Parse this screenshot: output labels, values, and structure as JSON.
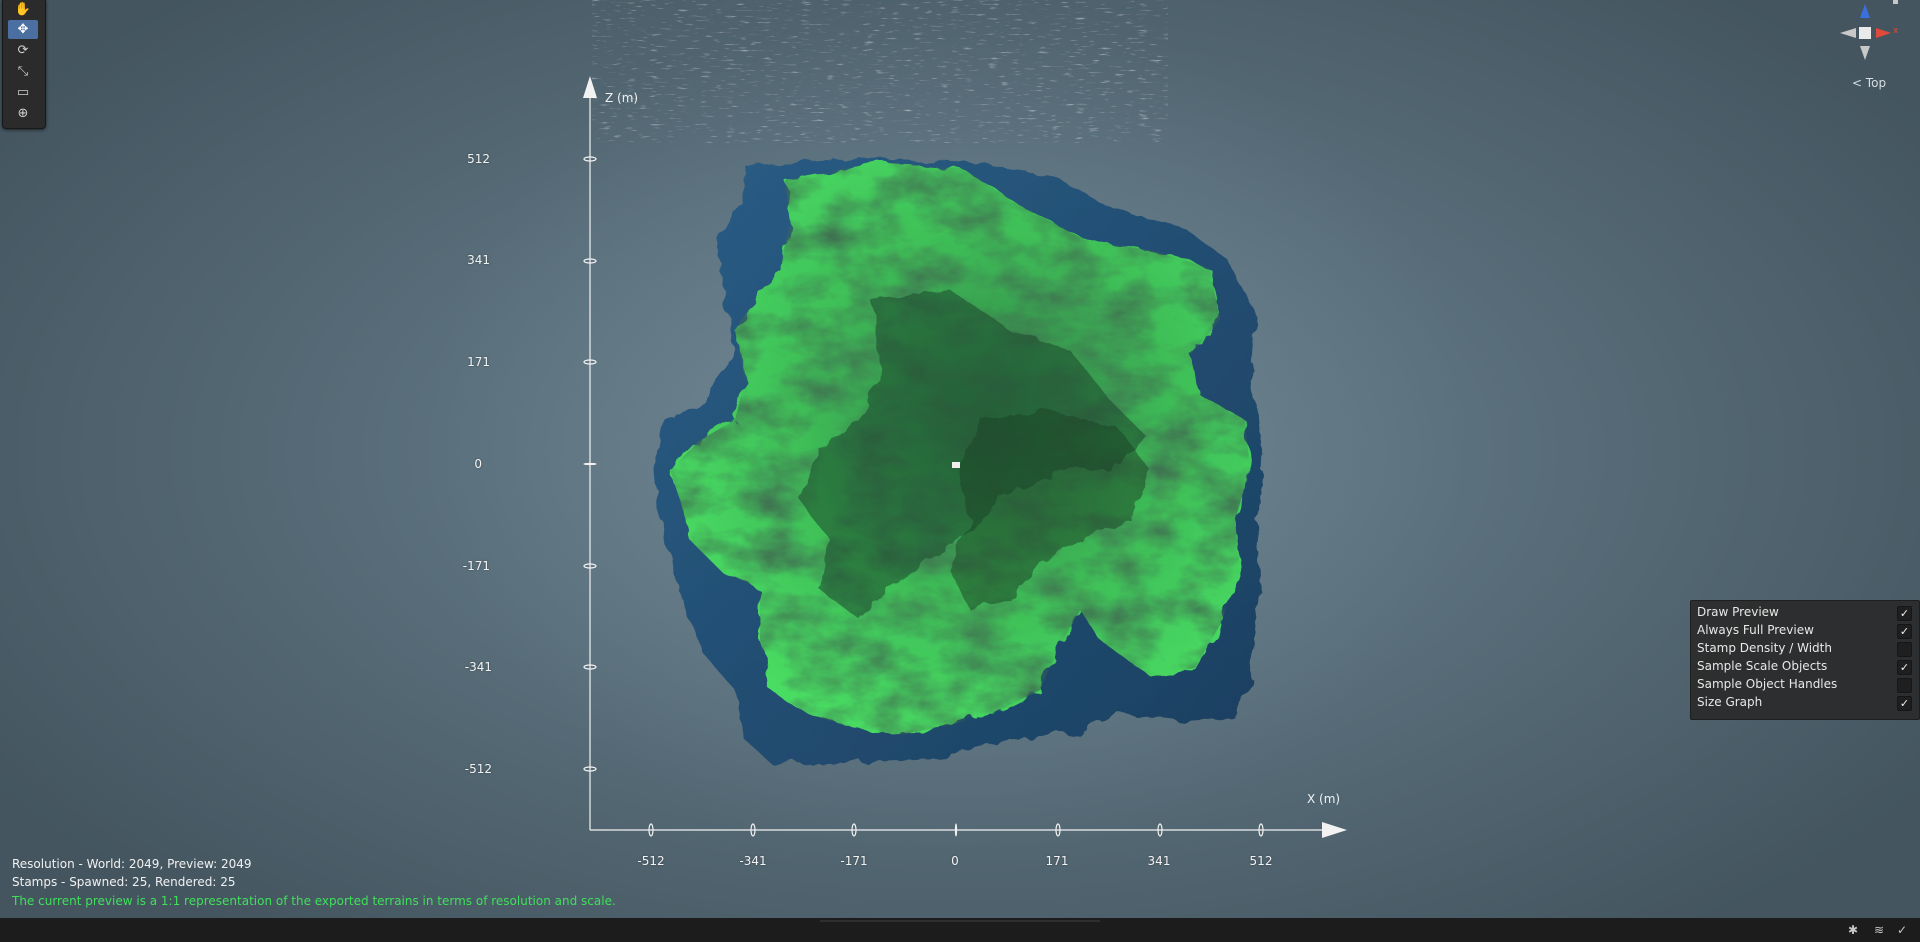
{
  "toolbar": {
    "tools": [
      {
        "name": "hand-tool-icon",
        "glyph": "✋",
        "active": false
      },
      {
        "name": "move-tool-icon",
        "glyph": "✥",
        "active": true
      },
      {
        "name": "rotate-tool-icon",
        "glyph": "⟳",
        "active": false
      },
      {
        "name": "scale-tool-icon",
        "glyph": "⤡",
        "active": false
      },
      {
        "name": "rect-tool-icon",
        "glyph": "▭",
        "active": false
      },
      {
        "name": "transform-tool-icon",
        "glyph": "⊕",
        "active": false
      }
    ]
  },
  "size_graph": {
    "z_axis_label": "Z (m)",
    "x_axis_label": "X (m)",
    "z_ticks": [
      "512",
      "341",
      "171",
      "0",
      "-171",
      "-341",
      "-512"
    ],
    "x_ticks": [
      "-512",
      "-341",
      "-171",
      "0",
      "171",
      "341",
      "512"
    ]
  },
  "gizmo": {
    "view_label": "< Top",
    "x_label": "x"
  },
  "overlay": {
    "options": [
      {
        "label": "Draw Preview",
        "checked": true
      },
      {
        "label": "Always Full Preview",
        "checked": true
      },
      {
        "label": "Stamp Density / Width",
        "checked": false
      },
      {
        "label": "Sample Scale Objects",
        "checked": true
      },
      {
        "label": "Sample Object Handles",
        "checked": false
      },
      {
        "label": "Size Graph",
        "checked": true
      }
    ]
  },
  "info": {
    "resolution": "Resolution - World: 2049, Preview: 2049",
    "stamps": "Stamps - Spawned: 25, Rendered: 25",
    "note": "The current preview is a 1:1 representation of the exported terrains in terms of resolution and scale."
  },
  "status_bar": {
    "icons": [
      "bug-icon",
      "layers-icon",
      "check-circle-icon"
    ]
  },
  "colors": {
    "terrain_green": "#3fd45a",
    "terrain_dark": "#2a5a3a",
    "terrain_blue": "#1f4a6e",
    "info_note": "#3fe05a",
    "active_tool": "#4a6fa0",
    "gizmo_x": "#e04a3a",
    "gizmo_y": "#3a6fe0"
  }
}
